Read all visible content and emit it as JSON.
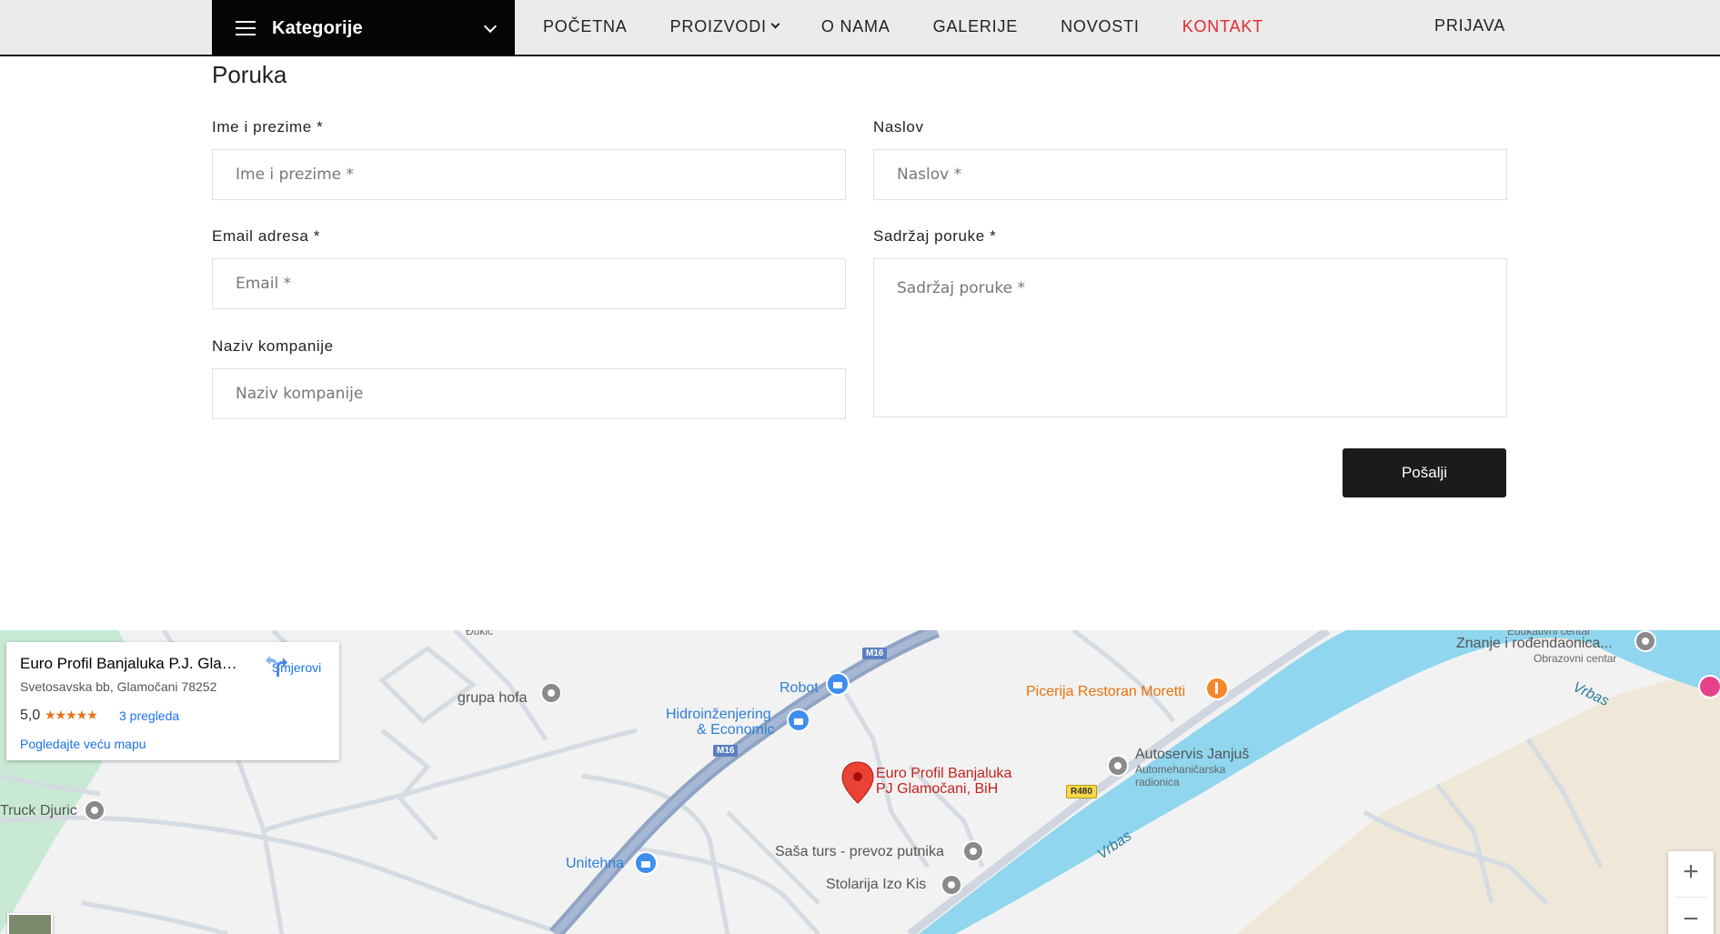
{
  "nav": {
    "categories_label": "Kategorije",
    "links": [
      "POČETNA",
      "PROIZVODI",
      "O NAMA",
      "GALERIJE",
      "NOVOSTI",
      "KONTAKT"
    ],
    "login": "PRIJAVA"
  },
  "form": {
    "title": "Poruka",
    "name_label": "Ime i prezime *",
    "name_placeholder": "Ime i prezime *",
    "subject_label": "Naslov",
    "subject_placeholder": "Naslov *",
    "email_label": "Email adresa *",
    "email_placeholder": "Email *",
    "message_label": "Sadržaj poruke *",
    "message_placeholder": "Sadržaj poruke *",
    "company_label": "Naziv kompanije",
    "company_placeholder": "Naziv kompanije",
    "submit": "Pošalji"
  },
  "map": {
    "card": {
      "name": "Euro Profil Banjaluka P.J. Glamočani, BiH",
      "address": "Svetosavska bb, Glamočani 78252",
      "rating": "5,0",
      "stars": "★★★★★",
      "reviews": "3 pregleda",
      "bigger_map": "Pogledajte veću mapu",
      "directions": "Smjerovi"
    },
    "labels": {
      "top_cut": "Đukić",
      "grupa_hofa": "grupa hofa",
      "robot": "Robot",
      "hidro_1": "Hidroinženjering",
      "hidro_2": "& Economic",
      "pizzeria": "Picerija Restoran Moretti",
      "edu_cut": "Edukativni centar",
      "edu_2": "Znanje i rođendaonica...",
      "edu_sub": "Obrazovni centar",
      "vrbas_1": "Vrbas",
      "vrbas_2": "Vrbas",
      "autoservis": "Autoservis Janjuš",
      "autoservis_sub1": "Automehaničarska",
      "autoservis_sub2": "radionica",
      "euro_1": "Euro Profil Banjaluka",
      "euro_2": "PJ Glamočani, BiH",
      "truck": "Truck Djuric",
      "unitehna": "Unitehna",
      "sasa": "Saša turs - prevoz putnika",
      "stolarija": "Stolarija Izo Kis",
      "m16_a": "M16",
      "m16_b": "M16",
      "r480": "R480"
    },
    "zoom_in": "+",
    "zoom_out": "−"
  }
}
